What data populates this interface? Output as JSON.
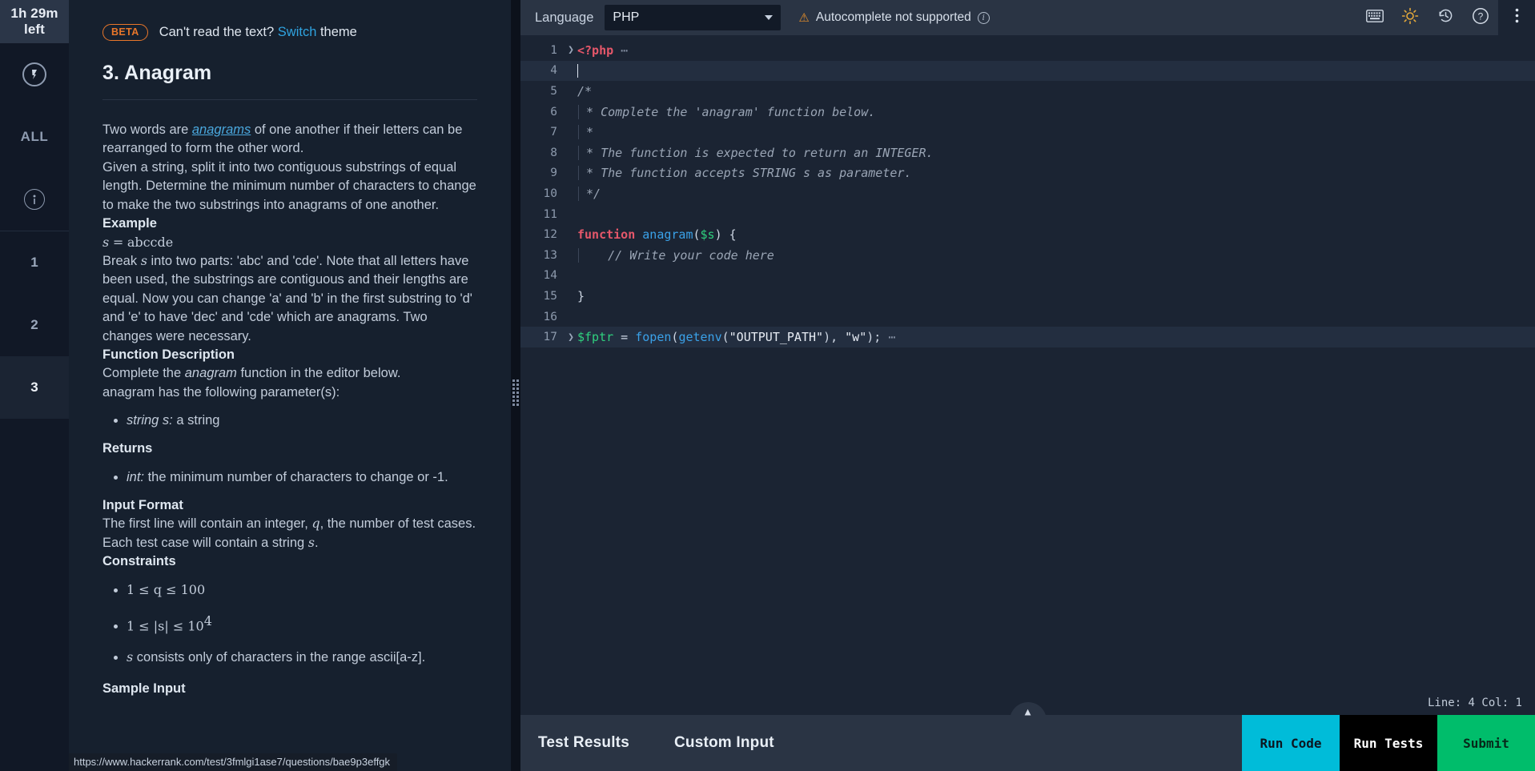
{
  "rail": {
    "timer": {
      "line1": "1h 29m",
      "line2": "left"
    },
    "logo_icon": "hackerrank-logo-icon",
    "all_label": "ALL",
    "info_icon": "info-circle-icon",
    "questions": [
      {
        "label": "1",
        "active": false
      },
      {
        "label": "2",
        "active": false
      },
      {
        "label": "3",
        "active": true
      }
    ]
  },
  "problem": {
    "beta_badge": "BETA",
    "beta_text_before": "Can't read the text? ",
    "beta_switch": "Switch",
    "beta_text_after": " theme",
    "title": "3. Anagram",
    "body": {
      "p1_a": "Two words are ",
      "p1_link": "anagrams",
      "p1_b": " of one another if their letters can be rearranged to form the other word.",
      "p2": "Given a string, split it into two contiguous substrings of equal length. Determine the minimum number of characters to change to make the two substrings into anagrams of one another.",
      "example_heading": "Example",
      "example_eq_var": "s",
      "example_eq_op": "=",
      "example_eq_val": "abccde",
      "p3_a": "Break ",
      "p3_var": "s",
      "p3_b": " into two parts: 'abc' and 'cde'. Note that all letters have been used, the substrings are contiguous and their lengths are equal. Now you can change 'a' and 'b' in the first substring to 'd' and 'e' to have 'dec' and 'cde' which are anagrams. Two changes were necessary.",
      "func_desc_heading": "Function Description",
      "func_desc_a": "Complete the ",
      "func_desc_name": "anagram",
      "func_desc_b": " function in the editor below.",
      "func_desc_c": "anagram has the following parameter(s):",
      "params": [
        {
          "name": "string s:",
          "desc": " a string"
        }
      ],
      "returns_heading": "Returns",
      "returns": [
        {
          "name": "int:",
          "desc": " the minimum number of characters to change or -1."
        }
      ],
      "input_format_heading": "Input Format",
      "input_format_a": "The first line will contain an integer, ",
      "input_format_q": "q",
      "input_format_b": ", the number of test cases.",
      "input_format_c1": "Each test case will contain a string ",
      "input_format_s": "s",
      "input_format_c2": ".",
      "constraints_heading": "Constraints",
      "constraint_1": "1 ≤ q ≤ 100",
      "constraint_2_a": "1 ≤ |s| ≤ 10",
      "constraint_2_sup": "4",
      "constraint_3_var": "s",
      "constraint_3_text": " consists only of characters in the range ascii[a-z].",
      "sample_input_heading": "Sample Input"
    }
  },
  "status_url": "https://www.hackerrank.com/test/3fmlgi1ase7/questions/bae9p3effgk",
  "editor": {
    "language_label": "Language",
    "language_value": "PHP",
    "autocomplete_warning": "Autocomplete not supported",
    "toolbar_icons": [
      "keyboard-icon",
      "brightness-icon",
      "history-icon",
      "help-circle-icon",
      "kebab-menu-icon"
    ],
    "status": "Line: 4 Col: 1",
    "collapse_icon": "chevron-up-icon",
    "lines": [
      {
        "num": "1",
        "fold": true,
        "indent": false,
        "highlight": false,
        "tokens": [
          {
            "t": "php",
            "v": "<?php"
          },
          {
            "t": "dots",
            "v": " ⋯"
          }
        ]
      },
      {
        "num": "4",
        "fold": false,
        "indent": false,
        "highlight": true,
        "tokens": [
          {
            "t": "caret",
            "v": ""
          }
        ]
      },
      {
        "num": "5",
        "fold": false,
        "indent": false,
        "highlight": false,
        "tokens": [
          {
            "t": "cmt",
            "v": "/*"
          }
        ]
      },
      {
        "num": "6",
        "fold": false,
        "indent": true,
        "highlight": false,
        "tokens": [
          {
            "t": "cmt",
            "v": " * Complete the 'anagram' function below."
          }
        ]
      },
      {
        "num": "7",
        "fold": false,
        "indent": true,
        "highlight": false,
        "tokens": [
          {
            "t": "cmt",
            "v": " *"
          }
        ]
      },
      {
        "num": "8",
        "fold": false,
        "indent": true,
        "highlight": false,
        "tokens": [
          {
            "t": "cmt",
            "v": " * The function is expected to return an INTEGER."
          }
        ]
      },
      {
        "num": "9",
        "fold": false,
        "indent": true,
        "highlight": false,
        "tokens": [
          {
            "t": "cmt",
            "v": " * The function accepts STRING s as parameter."
          }
        ]
      },
      {
        "num": "10",
        "fold": false,
        "indent": true,
        "highlight": false,
        "tokens": [
          {
            "t": "cmt",
            "v": " */"
          }
        ]
      },
      {
        "num": "11",
        "fold": false,
        "indent": true,
        "highlight": false,
        "tokens": []
      },
      {
        "num": "12",
        "fold": false,
        "indent": false,
        "highlight": false,
        "tokens": [
          {
            "t": "kw",
            "v": "function"
          },
          {
            "t": "plain",
            "v": " "
          },
          {
            "t": "fn",
            "v": "anagram"
          },
          {
            "t": "plain",
            "v": "("
          },
          {
            "t": "var",
            "v": "$s"
          },
          {
            "t": "plain",
            "v": ") {"
          }
        ]
      },
      {
        "num": "13",
        "fold": false,
        "indent": true,
        "highlight": false,
        "tokens": [
          {
            "t": "cmt",
            "v": "    // Write your code here"
          }
        ]
      },
      {
        "num": "14",
        "fold": false,
        "indent": true,
        "highlight": false,
        "tokens": []
      },
      {
        "num": "15",
        "fold": false,
        "indent": false,
        "highlight": false,
        "tokens": [
          {
            "t": "plain",
            "v": "}"
          }
        ]
      },
      {
        "num": "16",
        "fold": false,
        "indent": false,
        "highlight": false,
        "tokens": []
      },
      {
        "num": "17",
        "fold": true,
        "indent": false,
        "highlight": true,
        "tokens": [
          {
            "t": "var",
            "v": "$fptr"
          },
          {
            "t": "plain",
            "v": " = "
          },
          {
            "t": "fn",
            "v": "fopen"
          },
          {
            "t": "plain",
            "v": "("
          },
          {
            "t": "fn",
            "v": "getenv"
          },
          {
            "t": "plain",
            "v": "("
          },
          {
            "t": "str",
            "v": "\"OUTPUT_PATH\""
          },
          {
            "t": "plain",
            "v": "), "
          },
          {
            "t": "str",
            "v": "\"w\""
          },
          {
            "t": "plain",
            "v": ");"
          },
          {
            "t": "dots",
            "v": " ⋯"
          }
        ]
      }
    ]
  },
  "bottom": {
    "tabs": [
      {
        "label": "Test Results"
      },
      {
        "label": "Custom Input"
      }
    ],
    "actions": [
      {
        "label": "Run Code",
        "style": "run-code"
      },
      {
        "label": "Run Tests",
        "style": "run-tests"
      },
      {
        "label": "Submit",
        "style": "submit"
      }
    ]
  },
  "colors": {
    "accent_cyan": "#00bcd9",
    "accent_green": "#00bd6b",
    "link_blue": "#2fa3e0",
    "beta_orange": "#e8762a",
    "warn_orange": "#e8902a"
  }
}
